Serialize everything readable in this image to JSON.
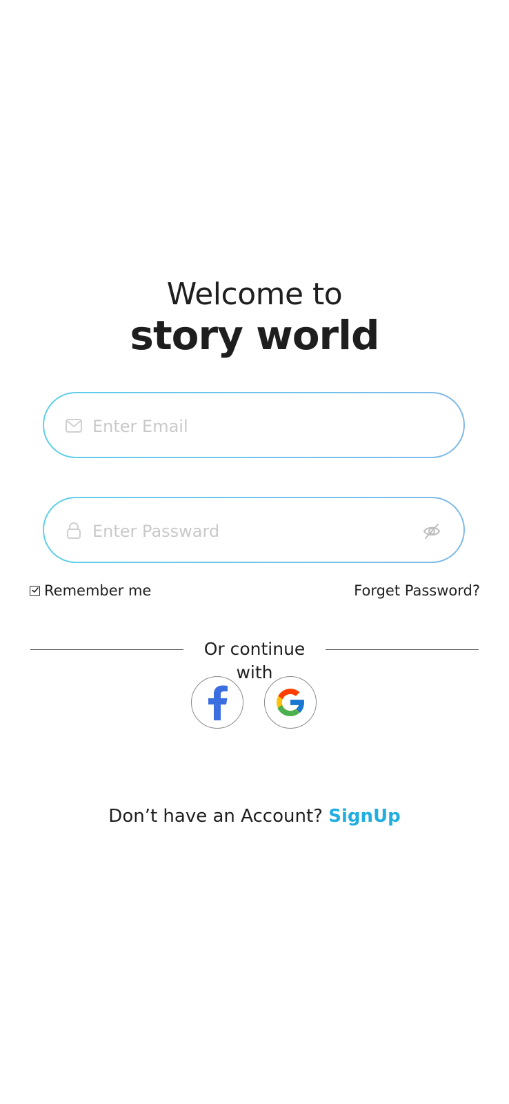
{
  "header": {
    "welcome": "Welcome to",
    "app_name": "story world"
  },
  "email_field": {
    "placeholder": "Enter Email",
    "value": "",
    "icon": "mail-icon"
  },
  "password_field": {
    "placeholder": "Enter Passward",
    "value": "",
    "icon": "lock-icon",
    "toggle_icon": "eye-off-icon"
  },
  "options": {
    "remember_label": "Remember me",
    "remember_checked": true,
    "forget_label": "Forget Password?"
  },
  "social": {
    "divider_label": "Or continue with",
    "providers": [
      {
        "name": "facebook",
        "icon": "facebook-icon",
        "color": "#3b6fe0"
      },
      {
        "name": "google",
        "icon": "google-icon"
      }
    ]
  },
  "footer": {
    "prompt": "Don’t have an Account?",
    "signup_label": "SignUp",
    "signup_color": "#22aee0"
  }
}
